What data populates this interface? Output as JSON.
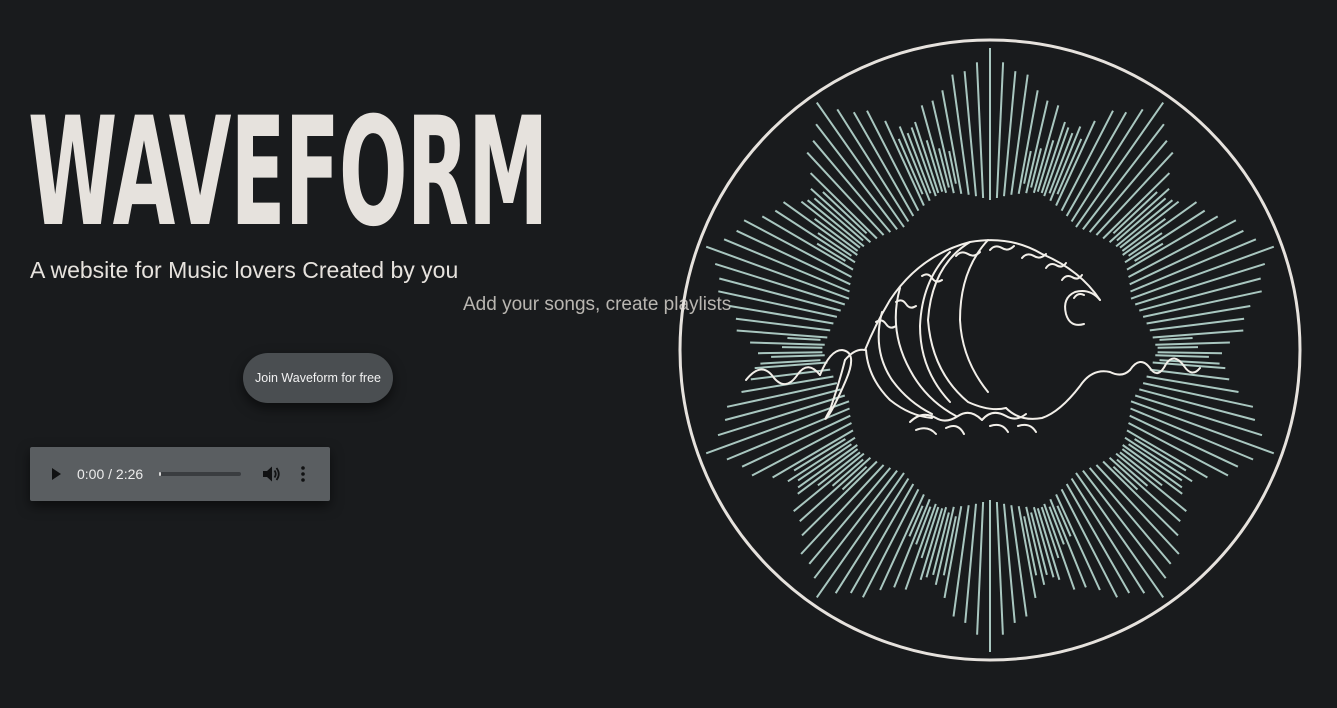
{
  "brand": {
    "title": "WAVEFORM",
    "tagline": "A website for Music lovers Created by you",
    "subtagline": "Add your songs, create playlists"
  },
  "cta": {
    "join_label": "Join Waveform for free"
  },
  "audio": {
    "current_time": "0:00",
    "duration": "2:26",
    "time_display": "0:00 / 2:26",
    "progress_fraction": 0.0
  },
  "colors": {
    "background": "#191b1d",
    "title_text": "#e6e2dd",
    "button_bg": "#4a4e51",
    "player_bg": "#5a5e61",
    "emblem_lines": "#a9c7c0",
    "emblem_circle": "#e6e2dd"
  },
  "icons": {
    "play": "play-icon",
    "volume": "volume-icon",
    "more": "more-vertical-icon",
    "emblem": "wave-emblem-icon"
  }
}
